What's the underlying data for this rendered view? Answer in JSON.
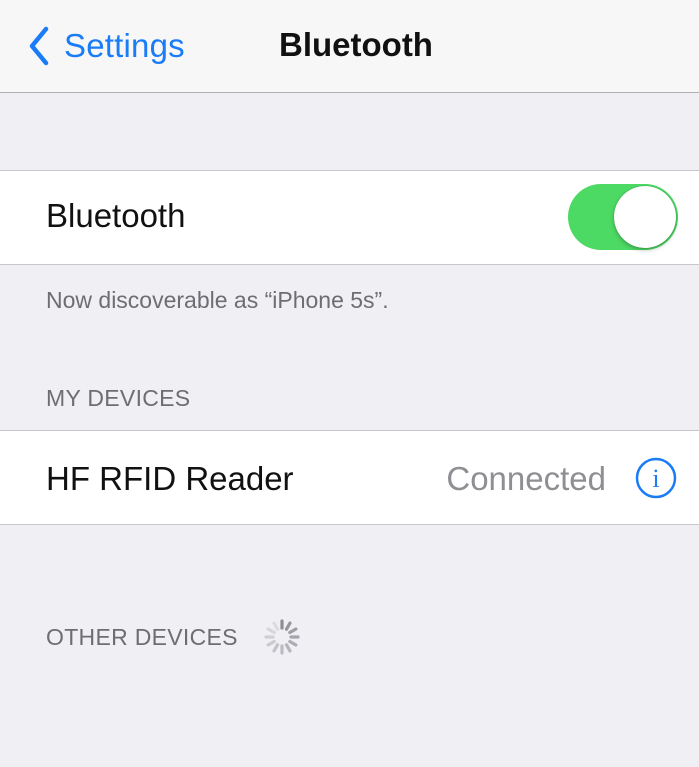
{
  "navbar": {
    "back_label": "Settings",
    "title": "Bluetooth"
  },
  "bluetooth_cell": {
    "label": "Bluetooth",
    "toggle_on": true
  },
  "discoverable_note": "Now discoverable as “iPhone 5s”.",
  "my_devices": {
    "header": "MY DEVICES",
    "items": [
      {
        "name": "HF RFID Reader",
        "status": "Connected",
        "icon": "info-icon"
      }
    ]
  },
  "other_devices": {
    "header": "OTHER DEVICES",
    "icon": "activity-spinner-icon"
  },
  "colors": {
    "accent": "#1a7cf6",
    "toggle_on": "#4cd964",
    "background": "#efeff4",
    "secondary_text": "#8e8e93"
  }
}
